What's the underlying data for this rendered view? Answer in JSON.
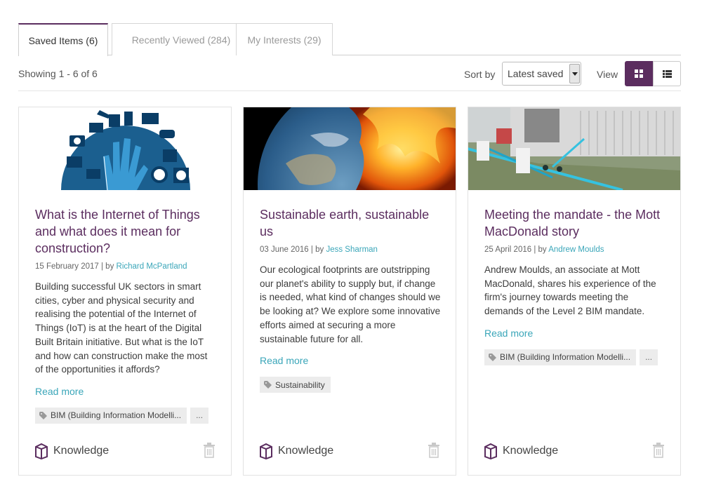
{
  "tabs": [
    {
      "label": "Saved Items (6)",
      "active": true
    },
    {
      "label": "Recently Viewed (284)",
      "active": false
    },
    {
      "label": "My Interests (29)",
      "active": false
    }
  ],
  "toolbar": {
    "showing": "Showing 1 - 6 of 6",
    "sort_label": "Sort by",
    "sort_value": "Latest saved",
    "view_label": "View",
    "view_options": [
      "grid-icon",
      "list-icon"
    ],
    "active_view": "grid"
  },
  "colors": {
    "accent": "#5b2d5f",
    "link": "#3aa6b9"
  },
  "cards": [
    {
      "image": "internet-of-things-illustration",
      "title": "What is the Internet of Things and what does it mean for construction?",
      "date": "15 February 2017",
      "by": "| by",
      "author": "Richard McPartland",
      "description": "Building successful UK sectors in smart cities, cyber and physical security and realising the potential of the Internet of Things (IoT) is at the heart of the Digital Built Britain initiative. But what is the IoT and how can construction make the most of the opportunities it affords?",
      "read_more": "Read more",
      "tags": [
        "BIM (Building Information Modelli..."
      ],
      "tag_more": "...",
      "category": "Knowledge"
    },
    {
      "image": "earth-on-fire-photo",
      "title": "Sustainable earth, sustainable us",
      "date": "03 June 2016",
      "by": "| by",
      "author": "Jess Sharman",
      "description": "Our ecological footprints are outstripping our planet's ability to supply but, if change is needed, what kind of changes should we be looking at? We explore some innovative efforts aimed at securing a more sustainable future for all.",
      "read_more": "Read more",
      "tags": [
        "Sustainability"
      ],
      "tag_more": "",
      "category": "Knowledge"
    },
    {
      "image": "bim-pipework-render",
      "title": "Meeting the mandate - the Mott MacDonald story",
      "date": "25 April 2016",
      "by": "| by",
      "author": "Andrew Moulds",
      "description": "Andrew Moulds, an associate at Mott MacDonald, shares his experience of the firm's journey towards meeting the demands of the Level 2 BIM mandate.",
      "read_more": "Read more",
      "tags": [
        "BIM (Building Information Modelli..."
      ],
      "tag_more": "...",
      "category": "Knowledge"
    }
  ]
}
